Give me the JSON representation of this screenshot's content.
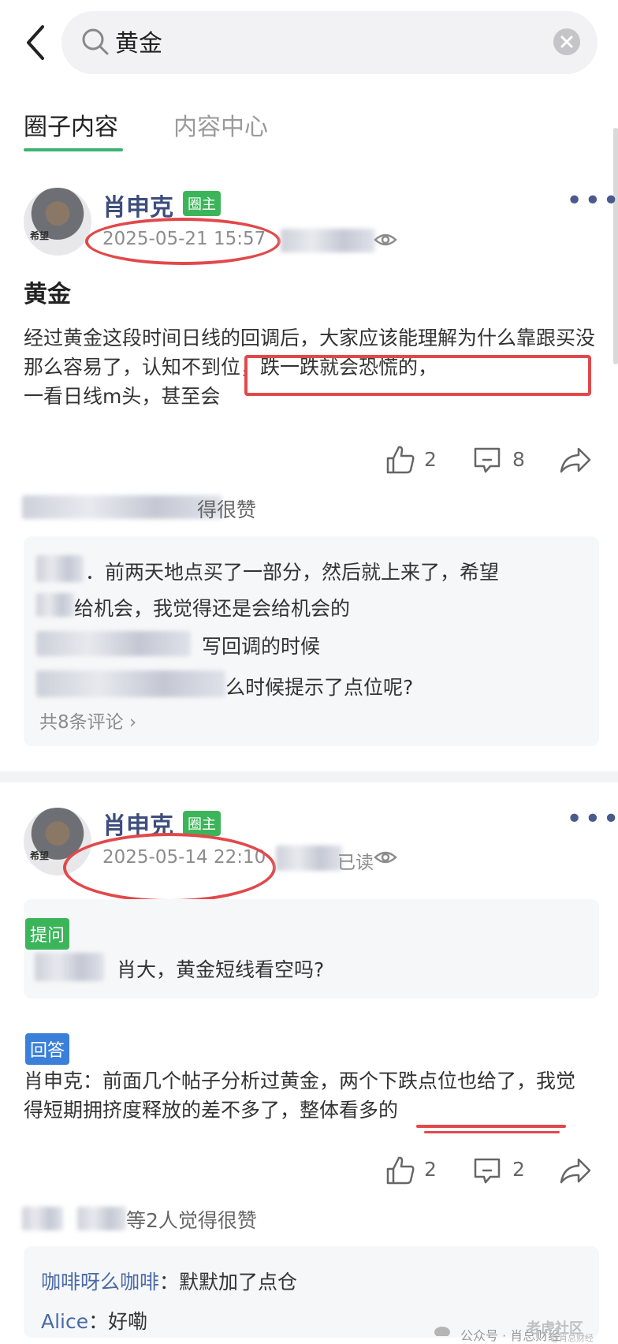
{
  "search": {
    "query": "黄金"
  },
  "tabs": [
    {
      "label": "圈子内容"
    },
    {
      "label": "内容中心"
    }
  ],
  "posts": [
    {
      "author": "肖申克",
      "badge": "圈主",
      "avatar_caption": "希望",
      "date": "2025-05-21 15:57",
      "title": "黄金",
      "body_plain": "经过黄金这段时间日线的回调后，大家应该能理解为什么靠跟买没那么容易了，",
      "body_highlight": "认知不到位，跌一跌就会恐慌的，",
      "body_tail": "一看日线m头，甚至会",
      "likes": "2",
      "comments": "8",
      "liked_by_suffix": "得很赞",
      "comment_lines": [
        "．前两天地点买了一部分，然后就上来了，希望",
        "给机会，我觉得还是会给机会的",
        "写回调的时候",
        "么时候提示了点位呢?"
      ],
      "more_comments": "共8条评论",
      "more_chevron": "›"
    },
    {
      "author": "肖申克",
      "badge": "圈主",
      "avatar_caption": "希望",
      "date": "2025-05-14 22:10",
      "read_suffix": "已读",
      "question_tag": "提问",
      "question": "肖大，黄金短线看空吗?",
      "answer_tag": "回答",
      "answer_prefix": "肖申克：前面几个帖子分析过黄金，两个下跌点位也给了，我觉得短期拥挤度释放的差不多了，",
      "answer_emphasis": "整体看多的",
      "likes": "2",
      "comments": "2",
      "liked_by_suffix": "等2人觉得很赞",
      "comments_list": [
        {
          "user": "咖啡呀么咖啡",
          "text": "：默默加了点仓"
        },
        {
          "user": "Alice",
          "text": "：好嘞"
        }
      ]
    }
  ],
  "watermark": {
    "wechat": "公众号 · 肖总财经",
    "brand": "老虎社区",
    "handle": "@肖总财经"
  },
  "colors": {
    "brand_green": "#3cb55a",
    "author_blue": "#3d4e7c",
    "annotation_red": "#e2484a",
    "answer_blue": "#3a7fd9"
  },
  "icons": [
    "back-arrow-icon",
    "search-icon",
    "clear-icon",
    "more-dots-icon",
    "eye-icon",
    "thumbs-up-icon",
    "comment-icon",
    "share-icon",
    "chevron-right-icon",
    "wechat-icon"
  ]
}
